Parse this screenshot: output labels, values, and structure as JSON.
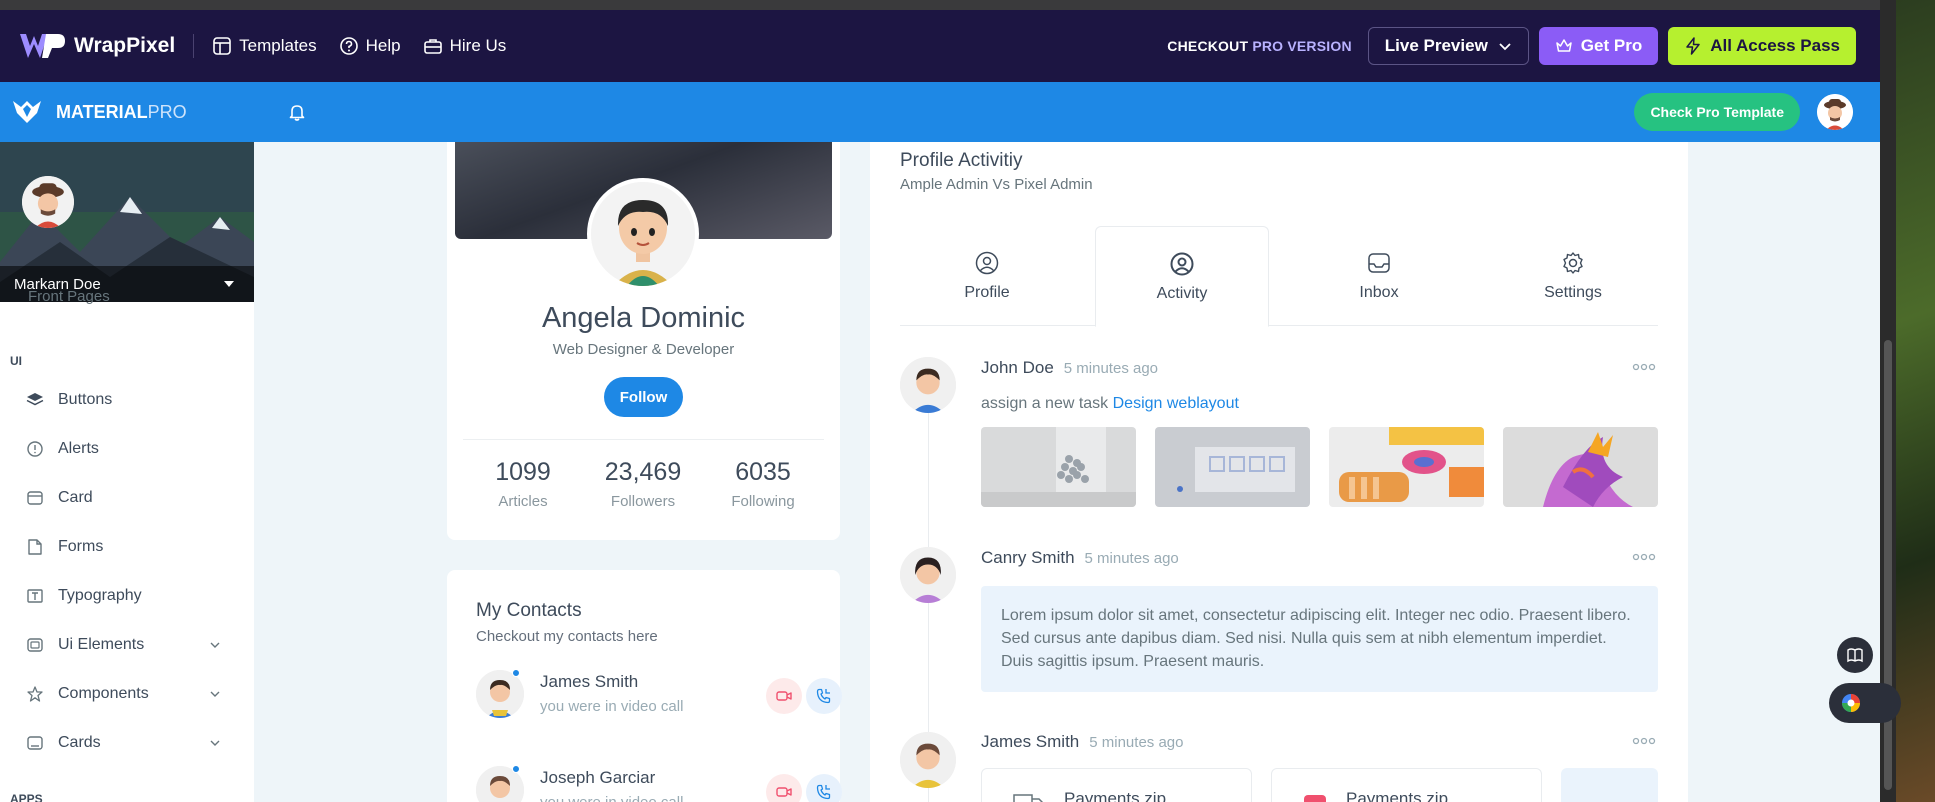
{
  "wrappixel": {
    "brand": "WrapPixel",
    "nav": [
      "Templates",
      "Help",
      "Hire Us"
    ],
    "checkout_prefix": "CHECKOUT ",
    "checkout_pro": "PRO",
    "checkout_suffix": " VERSION",
    "live_preview": "Live Preview",
    "get_pro": "Get Pro",
    "all_access": "All Access Pass"
  },
  "header": {
    "brand_bold": "MATERIAL",
    "brand_light": "PRO",
    "check_pro": "Check Pro Template"
  },
  "sidebar": {
    "user_name": "Markarn Doe",
    "cut_item": "Front Pages",
    "section_ui": "UI",
    "items": [
      {
        "label": "Buttons",
        "icon": "layers-icon"
      },
      {
        "label": "Alerts",
        "icon": "alert-circle-icon"
      },
      {
        "label": "Card",
        "icon": "card-icon"
      },
      {
        "label": "Forms",
        "icon": "forms-icon"
      },
      {
        "label": "Typography",
        "icon": "typography-icon"
      },
      {
        "label": "Ui Elements",
        "icon": "box-icon"
      },
      {
        "label": "Components",
        "icon": "components-icon"
      },
      {
        "label": "Cards",
        "icon": "cards-icon"
      }
    ],
    "section_apps": "APPS"
  },
  "profile": {
    "name": "Angela Dominic",
    "role": "Web Designer & Developer",
    "follow": "Follow",
    "stats": [
      {
        "value": "1099",
        "label": "Articles"
      },
      {
        "value": "23,469",
        "label": "Followers"
      },
      {
        "value": "6035",
        "label": "Following"
      }
    ]
  },
  "contacts": {
    "title": "My Contacts",
    "subtitle": "Checkout my contacts here",
    "items": [
      {
        "name": "James Smith",
        "status": "you were in video call"
      },
      {
        "name": "Joseph Garciar",
        "status": "you were in video call"
      }
    ]
  },
  "activity": {
    "title": "Profile Activitiy",
    "subtitle": "Ample Admin Vs Pixel Admin",
    "tabs": [
      "Profile",
      "Activity",
      "Inbox",
      "Settings"
    ],
    "active_tab": "Activity",
    "entries": [
      {
        "name": "John Doe",
        "time": "5 minutes ago"
      },
      {
        "name": "Canry Smith",
        "time": "5 minutes ago"
      },
      {
        "name": "James Smith",
        "time": "5 minutes ago"
      }
    ],
    "task_text": "assign a new task ",
    "task_link": "Design weblayout",
    "quote": "Lorem ipsum dolor sit amet, consectetur adipiscing elit. Integer nec odio. Praesent libero. Sed cursus ante dapibus diam. Sed nisi. Nulla quis sem at nibh elementum imperdiet. Duis sagittis ipsum. Praesent mauris.",
    "files": [
      "Payments.zip",
      "Payments.zip"
    ]
  },
  "colors": {
    "primary": "#1e88e5",
    "wp_dark": "#1c1542",
    "success": "#26c281",
    "lime": "#b6f02f",
    "purple": "#8b5cf6"
  }
}
